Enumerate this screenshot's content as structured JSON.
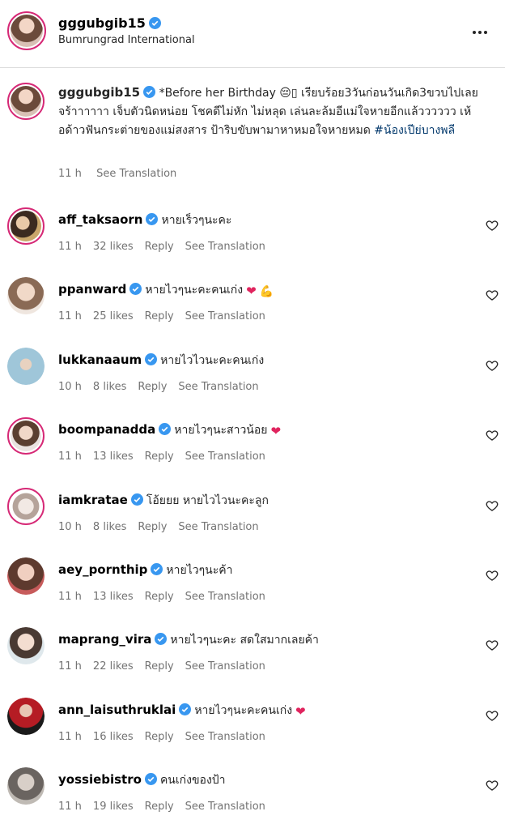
{
  "post": {
    "username": "gggubgib15",
    "location": "Bumrungrad International",
    "caption": "*Before her Birthday 😔▯ เรียบร้อย3วันก่อนวันเกิด3ขวบไปเลยจร้าาาาาา เจ็บตัวนิดหน่อย โชคดีไม่หัก ไม่หลุด เล่นละล้มอีแม่ใจหายอีกแล้วววววว เห้อด้าวฟันกระต่ายของแม่สงสาร ป้าริบขับพามาหาหมอใจหายหมด",
    "hashtag": "#น้องเปีย่บางพลี",
    "time": "11 h",
    "see_translation": "See Translation"
  },
  "labels": {
    "reply": "Reply",
    "see_translation": "See Translation"
  },
  "comments": [
    {
      "username": "aff_taksaorn",
      "text": "หายเร็วๆนะคะ",
      "time": "11 h",
      "likes": "32 likes"
    },
    {
      "username": "ppanward",
      "text": "หายไวๆนะคะคนเก่ง",
      "time": "11 h",
      "likes": "25 likes"
    },
    {
      "username": "lukkanaaum",
      "text": "หายไวไวนะคะคนเก่ง",
      "time": "10 h",
      "likes": "8 likes"
    },
    {
      "username": "boompanadda",
      "text": "หายไวๆนะสาวน้อย",
      "time": "11 h",
      "likes": "13 likes"
    },
    {
      "username": "iamkratae",
      "text": "โอ้ยยย หายไวไวนะคะลูก",
      "time": "10 h",
      "likes": "8 likes"
    },
    {
      "username": "aey_pornthip",
      "text": "หายไวๆนะค้า",
      "time": "11 h",
      "likes": "13 likes"
    },
    {
      "username": "maprang_vira",
      "text": "หายไวๆนะคะ สดใสมากเลยค้า",
      "time": "11 h",
      "likes": "22 likes"
    },
    {
      "username": "ann_laisuthruklai",
      "text": "หายไวๆนะคะคนเก่ง",
      "time": "11 h",
      "likes": "16 likes"
    },
    {
      "username": "yossiebistro",
      "text": "คนเก่งของป้า",
      "time": "11 h",
      "likes": "19 likes"
    }
  ],
  "colors": {
    "verified": "#3897f0",
    "story_ring": "#d62976",
    "heart_red": "#e0245e",
    "meta_gray": "#737373",
    "hashtag": "#00376b"
  }
}
